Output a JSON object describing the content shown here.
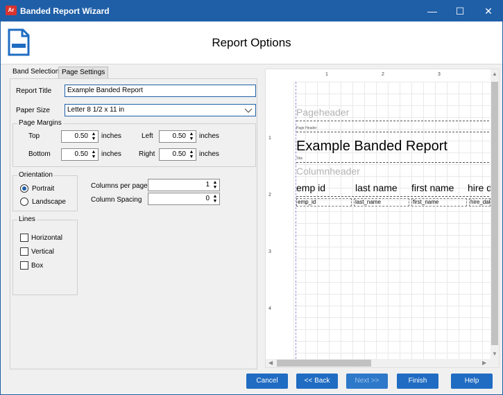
{
  "window": {
    "app_icon_label": "Ar",
    "title": "Banded Report Wizard"
  },
  "header": {
    "title": "Report Options"
  },
  "tabs": [
    {
      "label": "Band Selection"
    },
    {
      "label": "Page Settings"
    }
  ],
  "form": {
    "report_title_label": "Report Title",
    "report_title_value": "Example Banded Report",
    "paper_size_label": "Paper Size",
    "paper_size_value": "Letter 8 1/2 x 11 in",
    "margins": {
      "group_label": "Page Margins",
      "top_label": "Top",
      "top_value": "0.50",
      "left_label": "Left",
      "left_value": "0.50",
      "bottom_label": "Bottom",
      "bottom_value": "0.50",
      "right_label": "Right",
      "right_value": "0.50",
      "unit": "inches"
    },
    "orientation": {
      "group_label": "Orientation",
      "portrait_label": "Portrait",
      "landscape_label": "Landscape",
      "selected": "Portrait"
    },
    "columns_per_page_label": "Columns per page",
    "columns_per_page_value": "1",
    "column_spacing_label": "Column Spacing",
    "column_spacing_value": "0",
    "lines": {
      "group_label": "Lines",
      "horizontal_label": "Horizontal",
      "vertical_label": "Vertical",
      "box_label": "Box"
    }
  },
  "preview": {
    "ruler_top": [
      "1",
      "2",
      "3"
    ],
    "ruler_left": [
      "1",
      "2",
      "3",
      "4"
    ],
    "pageheader_band": "Pageheader",
    "page_header_small": "Page Header",
    "report_title": "Example Banded Report",
    "title_small": "Title",
    "columnheader_band": "Columnheader",
    "column_headers": [
      "emp id",
      "last name",
      "first name",
      "hire d"
    ],
    "fields": [
      "emp_id",
      "last_name",
      "first_name",
      "hire_dat"
    ]
  },
  "buttons": {
    "cancel": "Cancel",
    "back": "<< Back",
    "next": "Next >>",
    "finish": "Finish",
    "help": "Help"
  },
  "colors": {
    "accent": "#1f5fa8",
    "button": "#1f6cc2",
    "app_icon": "#d9332f"
  }
}
